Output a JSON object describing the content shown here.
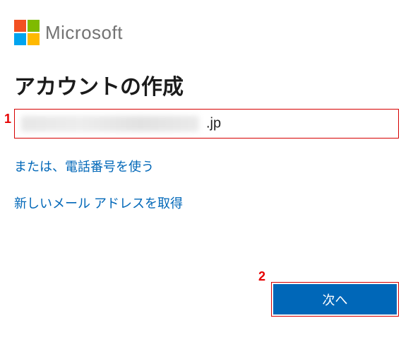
{
  "brand": {
    "name": "Microsoft"
  },
  "title": "アカウントの作成",
  "email": {
    "value": "",
    "domain_suffix": ".jp"
  },
  "links": {
    "use_phone": "または、電話番号を使う",
    "get_new_email": "新しいメール アドレスを取得"
  },
  "buttons": {
    "next": "次へ"
  },
  "annotations": {
    "one": "1",
    "two": "2"
  }
}
